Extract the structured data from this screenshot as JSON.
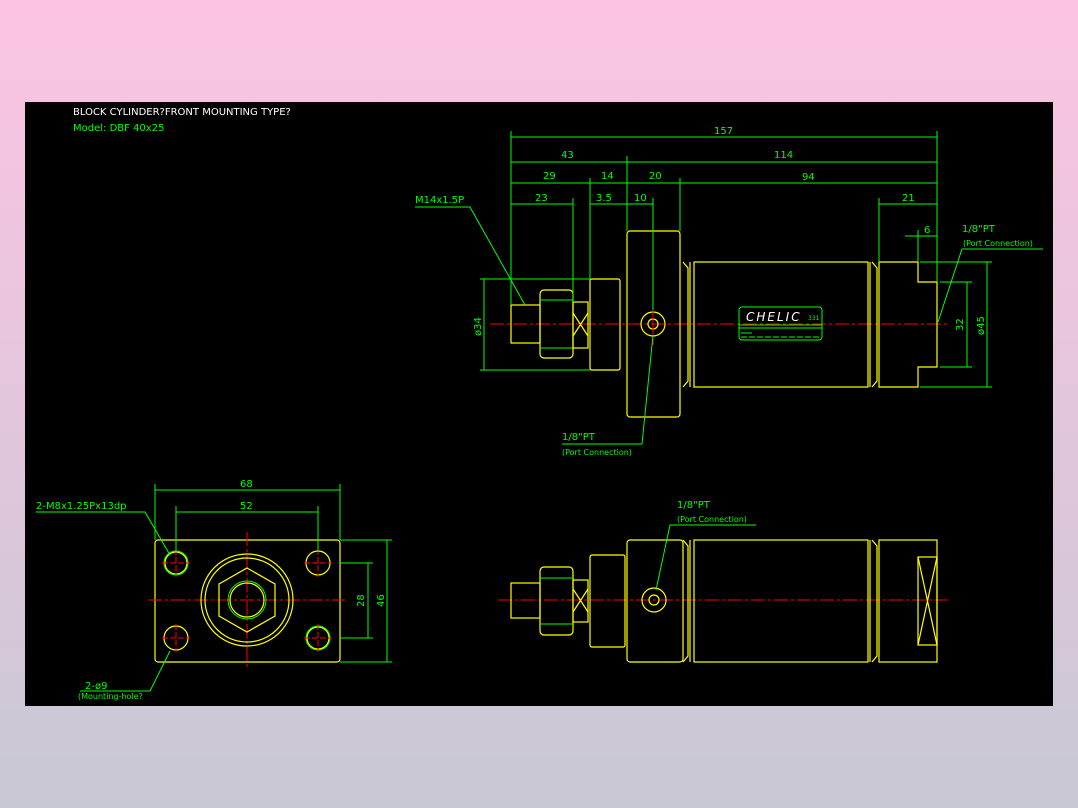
{
  "title": "BLOCK CYLINDER?FRONT MOUNTING TYPE?",
  "model": "Model: DBF 40x25",
  "colors": {
    "background": "#000000",
    "outline": "#ffff00",
    "dimension": "#00ff00",
    "centerline": "#ff0000",
    "title": "#ffffff"
  },
  "side_view": {
    "dims": {
      "d157": "157",
      "d43": "43",
      "d114": "114",
      "d29": "29",
      "d14": "14",
      "d20": "20",
      "d94": "94",
      "d23": "23",
      "d3_5": "3.5",
      "d10": "10",
      "d21": "21",
      "d6": "6",
      "d34": "ø34",
      "d32": "32",
      "d45": "ø45"
    },
    "thread_label": "M14x1.5P",
    "port_label_front": "1/8\"PT",
    "port_note_front": "(Port Connection)",
    "port_label_rear": "1/8\"PT",
    "port_note_rear": "(Port Connection)",
    "nameplate_brand": "CHELIC",
    "nameplate_code": "331"
  },
  "front_view": {
    "dims": {
      "d68": "68",
      "d52": "52",
      "d28": "28",
      "d46": "46"
    },
    "tap_label": "2-M8x1.25Px13dp",
    "hole_label": "2-ø9",
    "hole_note": "(Mounting-hole?"
  },
  "top_view": {
    "port_label": "1/8\"PT",
    "port_note": "(Port Connection)"
  }
}
